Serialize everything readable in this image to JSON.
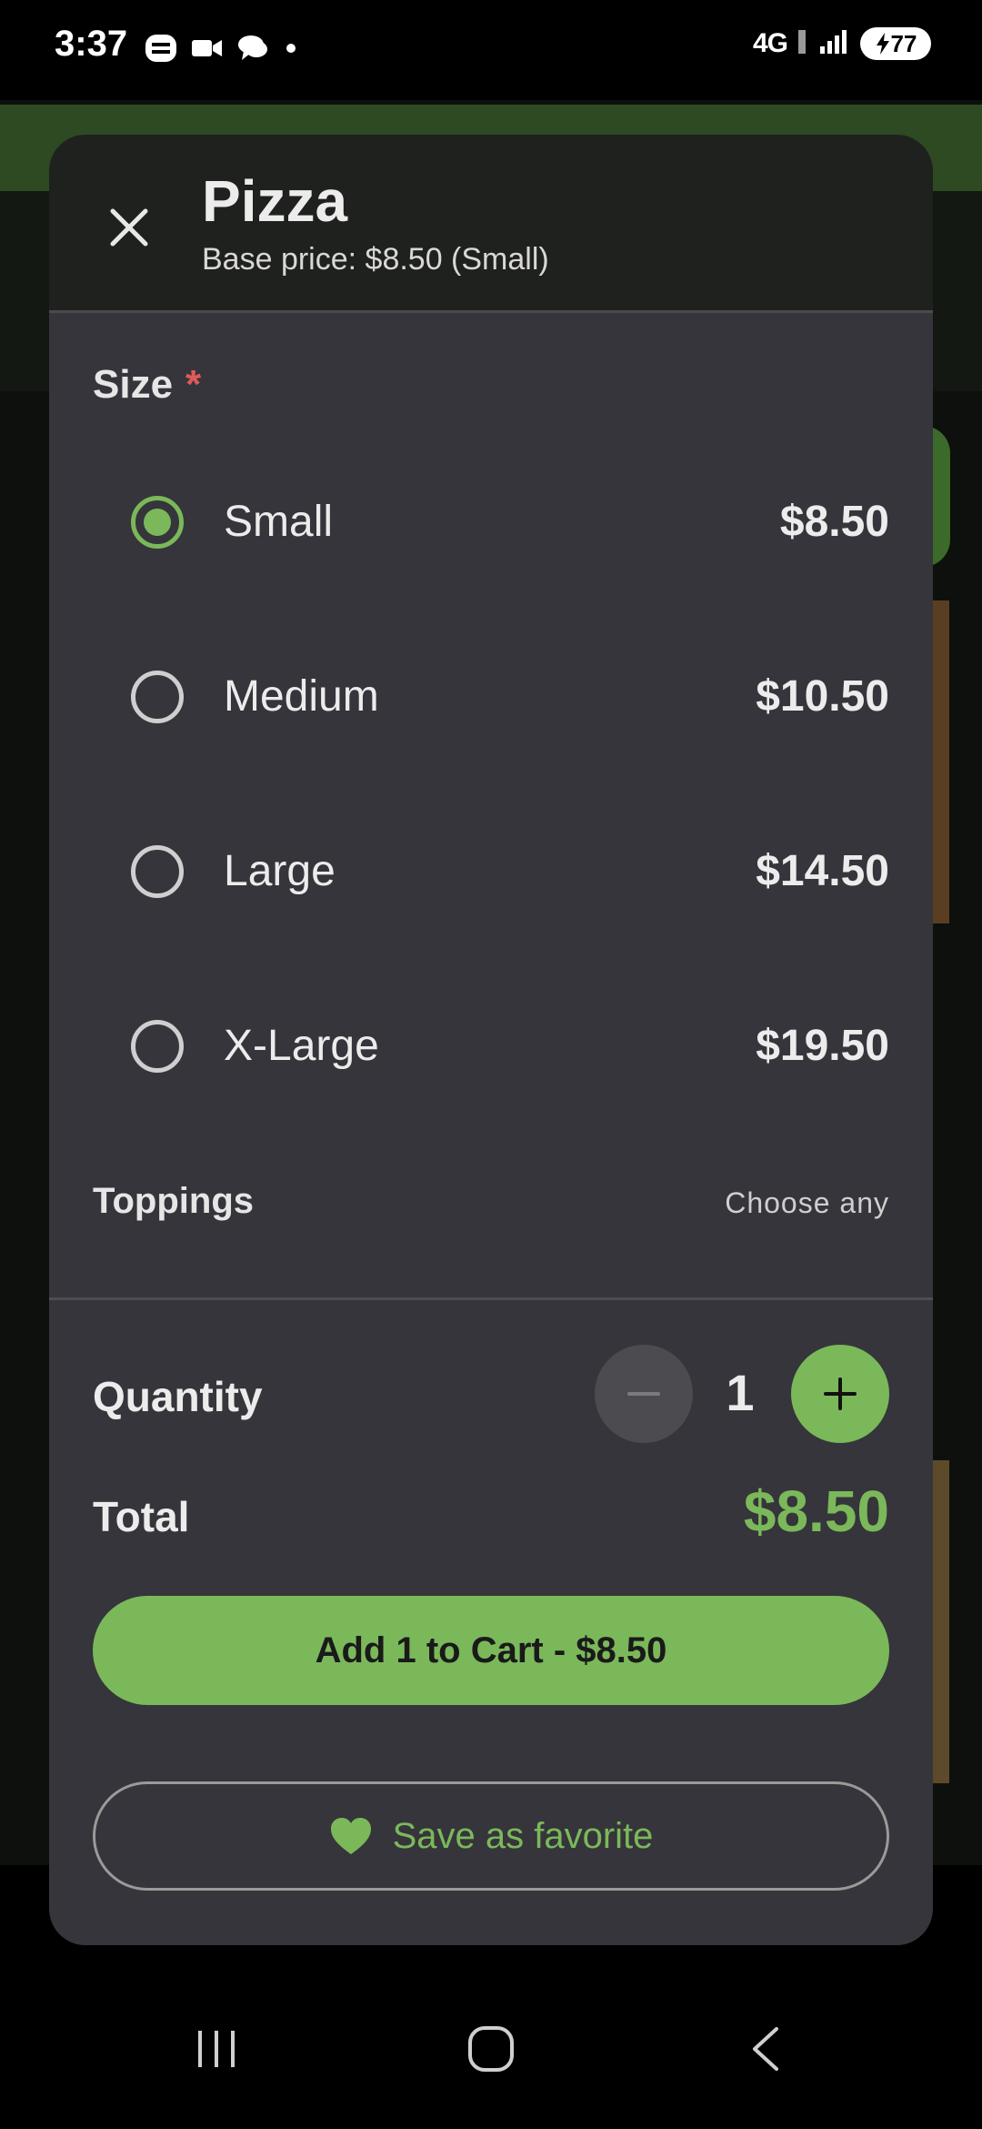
{
  "status_bar": {
    "time": "3:37",
    "network": "4G",
    "battery": "77",
    "icons": [
      "phone-app-icon",
      "video-icon",
      "chat-icon",
      "dot-icon",
      "lte-icon",
      "signal-icon",
      "battery-icon"
    ]
  },
  "modal": {
    "title": "Pizza",
    "subtitle": "Base price: $8.50 (Small)",
    "size_section": {
      "title": "Size",
      "required_marker": "*",
      "options": [
        {
          "label": "Small",
          "price": "$8.50",
          "selected": true
        },
        {
          "label": "Medium",
          "price": "$10.50",
          "selected": false
        },
        {
          "label": "Large",
          "price": "$14.50",
          "selected": false
        },
        {
          "label": "X-Large",
          "price": "$19.50",
          "selected": false
        }
      ]
    },
    "toppings_section": {
      "title": "Toppings",
      "hint": "Choose any"
    },
    "quantity": {
      "label": "Quantity",
      "value": "1"
    },
    "total": {
      "label": "Total",
      "value": "$8.50"
    },
    "add_button": "Add 1 to Cart - $8.50",
    "favorite_button": "Save as favorite"
  },
  "colors": {
    "accent": "#7bb85a",
    "sheet_bg": "#35353b",
    "header_bg": "#1f211e",
    "required": "#e05a5a"
  }
}
